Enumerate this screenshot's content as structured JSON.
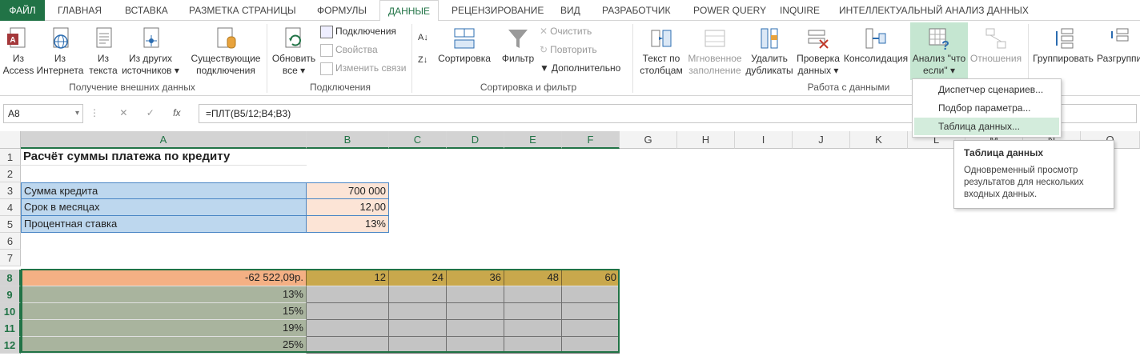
{
  "tabs": [
    "ФАЙЛ",
    "ГЛАВНАЯ",
    "ВСТАВКА",
    "РАЗМЕТКА СТРАНИЦЫ",
    "ФОРМУЛЫ",
    "ДАННЫЕ",
    "РЕЦЕНЗИРОВАНИЕ",
    "ВИД",
    "РАЗРАБОТЧИК",
    "POWER QUERY",
    "INQUIRE",
    "ИНТЕЛЛЕКТУАЛЬНЫЙ АНАЛИЗ ДАННЫХ"
  ],
  "active_tab": "ДАННЫЕ",
  "ribbon": {
    "ext": {
      "access": [
        "Из",
        "Access"
      ],
      "web": [
        "Из",
        "Интернета"
      ],
      "text": [
        "Из",
        "текста"
      ],
      "other": [
        "Из других",
        "источников ▾"
      ],
      "existing": [
        "Существующие",
        "подключения"
      ],
      "label": "Получение внешних данных"
    },
    "conn": {
      "refresh": [
        "Обновить",
        "все ▾"
      ],
      "connections": "Подключения",
      "properties": "Свойства",
      "edit_links": "Изменить связи",
      "label": "Подключения"
    },
    "sort": {
      "sort": "Сортировка",
      "filter": "Фильтр",
      "clear": "Очистить",
      "reapply": "Повторить",
      "advanced": "Дополнительно",
      "label": "Сортировка и фильтр"
    },
    "tools": {
      "text_to_cols": [
        "Текст по",
        "столбцам"
      ],
      "flash_fill": [
        "Мгновенное",
        "заполнение"
      ],
      "remove_dup": [
        "Удалить",
        "дубликаты"
      ],
      "validation": [
        "Проверка",
        "данных ▾"
      ],
      "consolidate": "Консолидация",
      "whatif": [
        "Анализ \"что",
        "если\" ▾"
      ],
      "relations": "Отношения",
      "label": "Работа с данными"
    },
    "outline": {
      "group": "Группировать",
      "ungroup": "Разгруппи"
    }
  },
  "formula_bar": {
    "name_box": "A8",
    "fx": "fx",
    "formula": "=ПЛТ(B5/12;B4;B3)"
  },
  "columns": [
    "A",
    "B",
    "C",
    "D",
    "E",
    "F",
    "G",
    "H",
    "I",
    "J",
    "K",
    "L",
    "M",
    "N",
    "O"
  ],
  "rows": [
    "1",
    "2",
    "3",
    "4",
    "5",
    "6",
    "7",
    "8",
    "9",
    "10",
    "11",
    "12"
  ],
  "sheet": {
    "title": "Расчёт суммы платежа по кредиту",
    "labels": [
      "Сумма кредита",
      "Срок в месяцах",
      "Процентная ставка"
    ],
    "values": [
      "700 000",
      "12,00",
      "13%"
    ],
    "payment": "-62 522,09р.",
    "terms": [
      "12",
      "24",
      "36",
      "48",
      "60"
    ],
    "rates": [
      "13%",
      "15%",
      "19%",
      "25%"
    ]
  },
  "menu": [
    "Диспетчер сценариев...",
    "Подбор параметра...",
    "Таблица данных..."
  ],
  "tooltip": {
    "title": "Таблица данных",
    "body": [
      "Одновременный просмотр",
      "результатов для нескольких",
      "входных данных."
    ]
  },
  "colors": {
    "accent": "#217346",
    "label_fill": "#bdd7ee",
    "value_fill": "#fce4d6",
    "payment_fill": "#f4b084",
    "term_fill": "#c9a84c",
    "rate_fill": "#a9b49e",
    "table_fill": "#c4c4c4"
  }
}
